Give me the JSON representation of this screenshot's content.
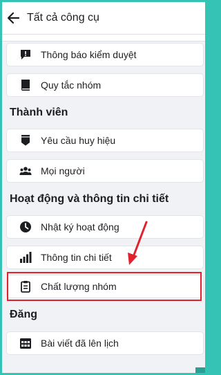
{
  "header": {
    "title": "Tất cả công cụ"
  },
  "sections": {
    "members": "Thành viên",
    "activity": "Hoạt động và thông tin chi tiết",
    "post": "Đăng"
  },
  "items": {
    "moderation_alerts": "Thông báo kiểm duyệt",
    "group_rules": "Quy tắc nhóm",
    "badge_requests": "Yêu cầu huy hiệu",
    "people": "Mọi người",
    "activity_log": "Nhật ký hoạt động",
    "insights": "Thông tin chi tiết",
    "group_quality": "Chất lượng nhóm",
    "scheduled_posts": "Bài viết đã lên lịch"
  },
  "annotation": {
    "highlight_color": "#e0222c"
  }
}
